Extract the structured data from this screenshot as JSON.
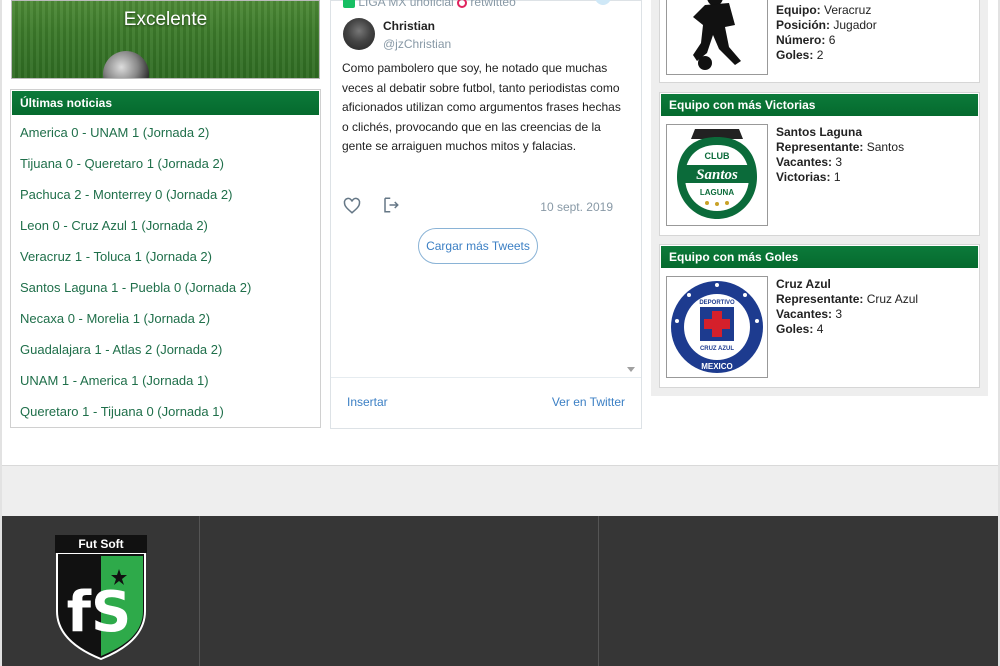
{
  "hero": {
    "title": "Excelente"
  },
  "news": {
    "header": "Últimas noticias",
    "items": [
      "America 0 - UNAM 1 (Jornada 2)",
      "Tijuana 0 - Queretaro 1 (Jornada 2)",
      "Pachuca 2 - Monterrey 0 (Jornada 2)",
      "Leon 0 - Cruz Azul 1 (Jornada 2)",
      "Veracruz 1 - Toluca 1 (Jornada 2)",
      "Santos Laguna 1 - Puebla 0 (Jornada 2)",
      "Necaxa 0 - Morelia 1 (Jornada 2)",
      "Guadalajara 1 - Atlas 2 (Jornada 2)",
      "UNAM 1 - America 1 (Jornada 1)",
      "Queretaro 1 - Tijuana 0 (Jornada 1)"
    ]
  },
  "tweet": {
    "retweet_source": "LIGA MX unoficial",
    "retweet_label": "retwitteó",
    "author_name": "Christian",
    "author_handle": "@jzChristian",
    "text": "Como pambolero que soy, he notado que muchas veces al debatir sobre futbol, tanto periodistas como aficionados utilizan como argumentos frases hechas o clichés, provocando que en las creencias de la gente se arraiguen muchos mitos y falacias.",
    "date": "10 sept. 2019",
    "load_more": "Cargar más Tweets",
    "footer_embed": "Insertar",
    "footer_twitter": "Ver en Twitter",
    "icons": [
      "heart-icon",
      "share-icon",
      "twitter-bird-icon",
      "retweet-icon"
    ]
  },
  "player_card": {
    "rows": [
      {
        "label": "Equipo:",
        "value": "Veracruz"
      },
      {
        "label": "Posición:",
        "value": "Jugador"
      },
      {
        "label": "Número:",
        "value": "6"
      },
      {
        "label": "Goles:",
        "value": "2"
      }
    ]
  },
  "victories_card": {
    "header": "Equipo con más Victorias",
    "team": "Santos Laguna",
    "rows": [
      {
        "label": "Representante:",
        "value": "Santos"
      },
      {
        "label": "Vacantes:",
        "value": "3"
      },
      {
        "label": "Victorias:",
        "value": "1"
      }
    ],
    "logo_text_top": "CLUB",
    "logo_text_main": "Santos",
    "logo_text_bottom": "LAGUNA"
  },
  "goals_card": {
    "header": "Equipo con más Goles",
    "team": "Cruz Azul",
    "rows": [
      {
        "label": "Representante:",
        "value": "Cruz Azul"
      },
      {
        "label": "Vacantes:",
        "value": "3"
      },
      {
        "label": "Goles:",
        "value": "4"
      }
    ],
    "logo_text_top": "DEPORTIVO",
    "logo_text_mid": "CRUZ AZUL",
    "logo_text_bottom": "MEXICO"
  },
  "footer": {
    "logo_caption": "Fut Soft",
    "logo_letters": "fS"
  },
  "colors": {
    "panel_green": "#0c7a3a",
    "link_green": "#1f6f4a",
    "twitter_blue": "#3b7fc4",
    "footer_dark": "#363636"
  }
}
